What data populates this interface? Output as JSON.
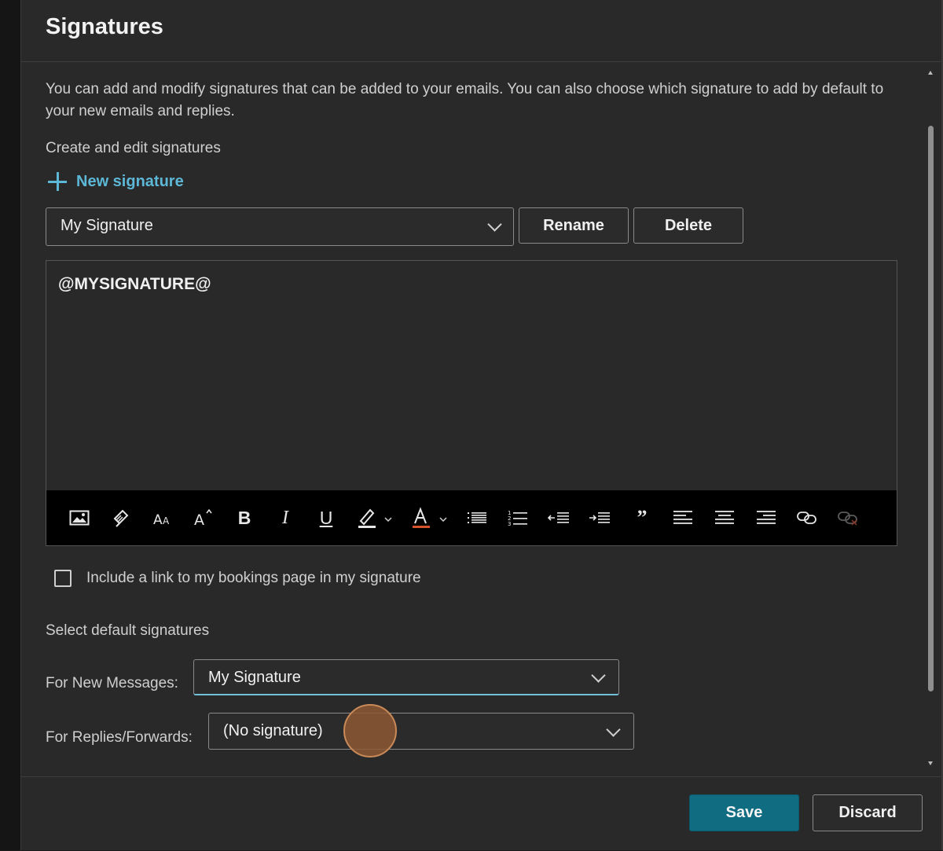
{
  "header": {
    "title": "Signatures"
  },
  "description": "You can add and modify signatures that can be added to your emails. You can also choose which signature to add by default to your new emails and replies.",
  "create_section": {
    "label": "Create and edit signatures",
    "new_signature_label": "New signature",
    "selected_signature": "My Signature",
    "rename_label": "Rename",
    "delete_label": "Delete"
  },
  "editor": {
    "content": "@MYSIGNATURE@"
  },
  "toolbar": {
    "tools": [
      "insert-image",
      "format-painter",
      "font-size",
      "text-effects",
      "bold",
      "italic",
      "underline",
      "highlight",
      "font-color",
      "bullets",
      "numbering",
      "decrease-indent",
      "increase-indent",
      "quote",
      "align-left",
      "align-center",
      "align-right",
      "insert-link",
      "remove-link"
    ],
    "bold_glyph": "B",
    "italic_glyph": "I",
    "underline_glyph": "U",
    "quote_glyph": "”"
  },
  "bookings": {
    "checked": false,
    "label": "Include a link to my bookings page in my signature"
  },
  "defaults_section": {
    "label": "Select default signatures",
    "new_messages_label": "For New Messages:",
    "new_messages_value": "My Signature",
    "replies_label": "For Replies/Forwards:",
    "replies_value": "(No signature)"
  },
  "footer": {
    "save_label": "Save",
    "discard_label": "Discard"
  },
  "colors": {
    "accent": "#5cb8d6",
    "primary_button": "#0f6c81",
    "panel_bg": "#292929",
    "toolbar_bg": "#000000",
    "focus_underline": "#6fc0d8"
  }
}
